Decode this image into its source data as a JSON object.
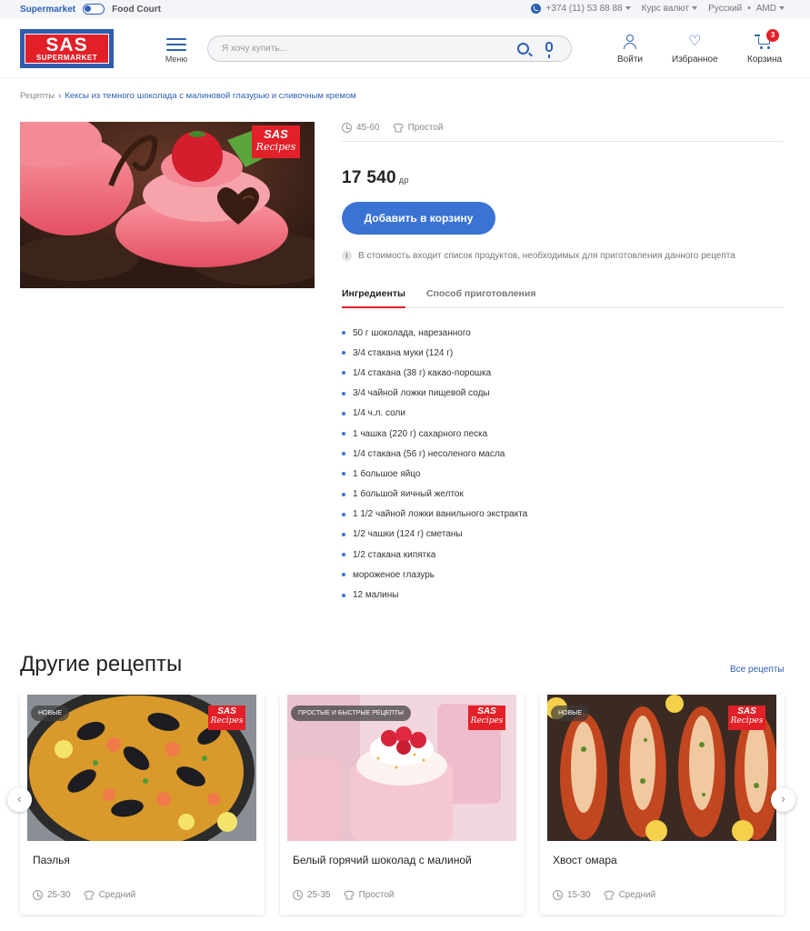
{
  "topbar": {
    "supermarket": "Supermarket",
    "food_court": "Food Court",
    "phone": "+374 (11) 53 88 88",
    "currency_rate": "Курс валют",
    "language": "Русский",
    "separator": "•",
    "currency": "AMD"
  },
  "header": {
    "logo_big": "SAS",
    "logo_small": "SUPERMARKET",
    "menu_label": "Меню",
    "search_placeholder": "Я хочу купить...",
    "login_label": "Войти",
    "favorites_label": "Избранное",
    "cart_label": "Корзина",
    "cart_count": "3"
  },
  "breadcrumb": {
    "root": "Рецепты",
    "current": "Кексы из темного шоколада с малиновой глазурью и сливочным кремом"
  },
  "recipe": {
    "time": "45-60",
    "difficulty": "Простой",
    "price": "17 540",
    "currency_unit": "др",
    "add_to_cart": "Добавить  в корзину",
    "note": "В стоимость входит список продуктов, необходимых для приготовления данного рецепта",
    "tab_ingredients": "Ингредиенты",
    "tab_method": "Способ приготовления",
    "ingredients": [
      "50 г шоколада, нарезанного",
      "3/4 стакана муки (124 г)",
      "1/4 стакана (38 г) какао-порошка",
      "3/4 чайной ложки пищевой соды",
      "1/4 ч.л. соли",
      "1 чашка (220 г) сахарного песка",
      "1/4 стакана (56 г) несоленого масла",
      "1 большое яйцо",
      "1 большой яичный желток",
      "1 1/2 чайной ложки ванильного экстракта",
      "1/2 чашки (124 г) сметаны",
      "1/2 стакана кипятка",
      "мороженое глазурь",
      "12 малины"
    ],
    "badge_t1": "SAS",
    "badge_t2": "Recipes"
  },
  "other": {
    "title": "Другие рецепты",
    "all_link": "Все рецепты",
    "cards": [
      {
        "name": "Паэлья",
        "tag": "НОВЫЕ",
        "time": "25-30",
        "difficulty": "Средний"
      },
      {
        "name": "Белый горячий шоколад с малиной",
        "tag": "ПРОСТЫЕ И БЫСТРЫЕ РЕЦЕПТЫ",
        "time": "25-35",
        "difficulty": "Простой"
      },
      {
        "name": "Хвост омара",
        "tag": "НОВЫЕ",
        "time": "15-30",
        "difficulty": "Средний"
      }
    ],
    "prev": "‹",
    "next": "›"
  },
  "colors": {
    "brand_blue": "#2e60b6",
    "brand_red": "#e32028",
    "button_blue": "#3a73d3"
  }
}
